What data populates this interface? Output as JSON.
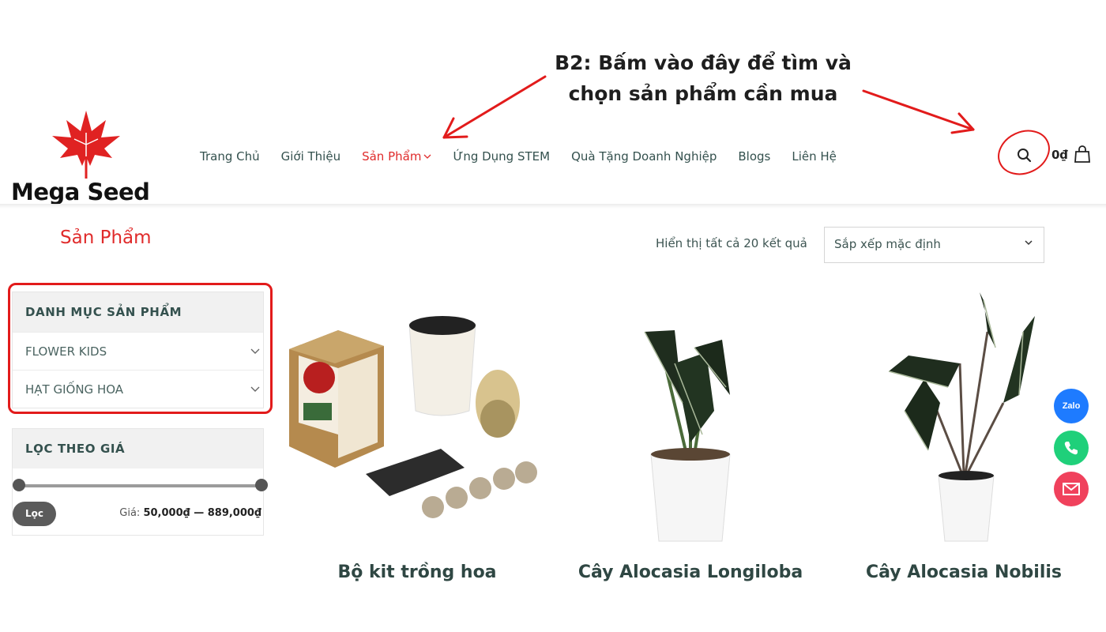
{
  "annotation": {
    "line1": "B2: Bấm vào đây để tìm và",
    "line2": "chọn sản phẩm cần mua",
    "color": "#e21b1b"
  },
  "header": {
    "logo_text": "Mega Seed",
    "nav": [
      {
        "label": "Trang Chủ"
      },
      {
        "label": "Giới Thiệu"
      },
      {
        "label": "Sản Phẩm",
        "active": true
      },
      {
        "label": "Ứng Dụng STEM"
      },
      {
        "label": "Quà Tặng Doanh Nghiệp"
      },
      {
        "label": "Blogs"
      },
      {
        "label": "Liên Hệ"
      }
    ],
    "cart_total": "0₫",
    "icons": [
      "search-icon",
      "cart-bag-icon",
      "chevron-down-icon"
    ]
  },
  "page": {
    "title": "Sản Phẩm",
    "result_count": "Hiển thị tất cả 20 kết quả",
    "sort_value": "Sắp xếp mặc định"
  },
  "sidebar": {
    "categories_title": "DANH MỤC SẢN PHẨM",
    "categories": [
      {
        "label": "FLOWER KIDS"
      },
      {
        "label": "HẠT GIỐNG HOA"
      }
    ],
    "price_filter_title": "LỌC THEO GIÁ",
    "filter_button": "Lọc",
    "price_prefix": "Giá:",
    "price_min": "50,000₫",
    "price_sep": " — ",
    "price_max": "889,000₫"
  },
  "products": [
    {
      "name": "Bộ kit trồng hoa"
    },
    {
      "name": "Cây Alocasia Longiloba"
    },
    {
      "name": "Cây Alocasia Nobilis"
    }
  ],
  "contact": {
    "zalo_label": "Zalo"
  },
  "colors": {
    "accent": "#e02b2b",
    "nav_text": "#34514e",
    "zalo": "#1e7bff",
    "phone": "#1fd07a",
    "mail": "#f0415c"
  }
}
